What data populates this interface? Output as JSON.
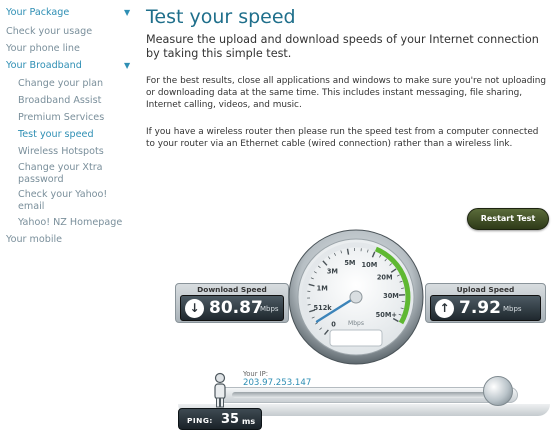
{
  "sidebar": {
    "items": [
      {
        "label": "Your Package",
        "type": "head",
        "arrow": "▼"
      },
      {
        "label": "Check your usage"
      },
      {
        "label": "Your phone line"
      },
      {
        "label": "Your Broadband",
        "type": "head",
        "arrow": "▼"
      },
      {
        "label": "Change your plan"
      },
      {
        "label": "Broadband Assist"
      },
      {
        "label": "Premium Services"
      },
      {
        "label": "Test your speed",
        "active": true
      },
      {
        "label": "Wireless Hotspots"
      },
      {
        "label": "Change your Xtra password"
      },
      {
        "label": "Check your Yahoo! email"
      },
      {
        "label": "Yahoo! NZ Homepage"
      },
      {
        "label": "Your mobile"
      }
    ]
  },
  "main": {
    "title": "Test your speed",
    "intro": "Measure the upload and download speeds of your Internet connection by taking this simple test.",
    "para1": "For the best results, close all applications and windows to make sure you're not uploading or downloading data at the same time. This includes instant messaging, file sharing, Internet calling, videos, and music.",
    "para2": "If you have a wireless router then please run the speed test from a computer connected to your router via an Ethernet cable (wired connection) rather than a wireless link."
  },
  "speedtest": {
    "restart_label": "Restart Test",
    "download": {
      "label": "Download Speed",
      "value": "80.87",
      "unit": "Mbps",
      "icon": "arrow-down-icon"
    },
    "upload": {
      "label": "Upload Speed",
      "value": "7.92",
      "unit": "Mbps",
      "icon": "arrow-up-icon"
    },
    "gauge": {
      "ticks": [
        "0",
        "512k",
        "1M",
        "3M",
        "5M",
        "10M",
        "20M",
        "30M",
        "50M+"
      ],
      "unit": "Mbps",
      "accent": "#5fb832"
    },
    "ip_label": "Your IP:",
    "ip": "203.97.253.147",
    "ping_label": "PING:",
    "ping_value": "35",
    "ping_unit": "ms"
  }
}
